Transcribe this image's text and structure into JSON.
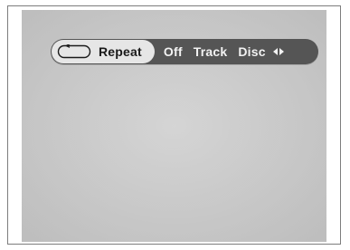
{
  "repeat_menu": {
    "label": "Repeat",
    "icon": "repeat-icon",
    "options": [
      "Off",
      "Track",
      "Disc"
    ],
    "adjust_icon": "left-right-arrows-icon"
  },
  "colors": {
    "bar": "#555555",
    "chip": "#e6e6e6",
    "option_text": "#f2f2f2",
    "screen": "#dadada"
  }
}
